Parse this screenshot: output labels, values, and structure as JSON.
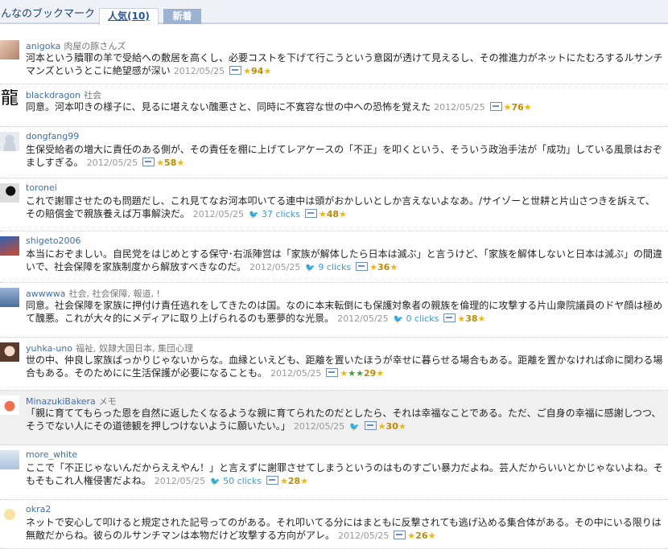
{
  "header": {
    "title": "みんなのブックマーク",
    "tab_popular": "人気(10)",
    "tab_new": "新着"
  },
  "entries": [
    {
      "user": "anigoka",
      "tags": "肉屋の豚さんズ",
      "text": "河本という贖罪の羊で受給への敷居を高くし、必要コストを下げて行こうという意図が透けて見えるし、その推進力がネットにたむろするルサンチマンズというとこに絶望感が深い",
      "date": "2012/05/25",
      "clicks": "",
      "stars": "94",
      "avatar": "avatar-photo"
    },
    {
      "user": "blackdragon",
      "tags": "社会",
      "text": "同意。河本叩きの様子に、見るに堪えない醜悪さと、同時に不寛容な世の中への恐怖を覚えた",
      "date": "2012/05/25",
      "clicks": "",
      "stars": "76",
      "avatar": "dragon-kanji",
      "kanji": "龍"
    },
    {
      "user": "dongfang99",
      "tags": "",
      "text": "生保受給者の増大に責任のある側が、その責任を棚に上げてレアケースの「不正」を叩くという、そういう政治手法が「成功」している風景はおぞましすぎる。",
      "date": "2012/05/25",
      "clicks": "",
      "stars": "58",
      "avatar": "default-silhouette"
    },
    {
      "user": "toronei",
      "tags": "",
      "text": "これで謝罪させたのも問題だし、これ見てなお河本叩いてる連中は頭がおかしいとしか言えないよなあ。/サイゾーと世耕と片山さつきを訴えて、その賠償金で親族養えば万事解決だ。",
      "date": "2012/05/25",
      "clicks": "37 clicks",
      "stars": "48",
      "avatar": "dark-figure"
    },
    {
      "user": "shigeto2006",
      "tags": "",
      "text": "本当におぞましい。自民党をはじめとする保守･右派陣営は「家族が解体したら日本は滅ぶ」と言うけど、「家族を解体しないと日本は滅ぶ」の間違いで、社会保障を家族制度から解放すべきなのだ。",
      "date": "2012/05/25",
      "clicks": "9 clicks",
      "stars": "36",
      "avatar": "avatar-blue"
    },
    {
      "user": "awwwwa",
      "tags": "社会, 社会保障, 報道, !",
      "text": "同意。社会保障を家族に押付け責任逃れをしてきたのは国。なのに本末転倒にも保護対象者の親族を倫理的に攻撃する片山衆院議員のドヤ顔は極めて醜悪。これが大々的にメディアに取り上げられるのも悪夢的な光景。",
      "date": "2012/05/25",
      "clicks": "0 clicks",
      "stars": "38",
      "avatar": "avatar-city"
    },
    {
      "user": "yuhka-uno",
      "tags": "福祉, 奴隷大国日本, 集団心理",
      "text": "世の中、仲良し家族ばっかりじゃないからな。血縁といえども、距離を置いたほうが幸せに暮らせる場合もある。距離を置かなければ命に関わる場合もある。そのためにに生活保護が必要になることも。",
      "date": "2012/05/25",
      "clicks": "",
      "stars": "29",
      "avatar": "avatar-doll",
      "green": true
    },
    {
      "user": "MinazukiBakera",
      "tags": "メモ",
      "text": "「親に育ててもらった恩を自然に返したくなるような親に育てられたのだとしたら、それは幸福なことである。ただ、ご自身の幸福に感謝しつつ、そうでない人にその道徳観を押しつけないように願いたい。」",
      "date": "2012/05/25",
      "clicks": "",
      "stars": "30",
      "avatar": "avatar-crab",
      "twitter_only": true,
      "highlight": true
    },
    {
      "user": "more_white",
      "tags": "",
      "text": "ここで「不正じゃないんだからええやん！」と言えずに謝罪させてしまうというのはものすごい暴力だよね。芸人だからいいとかじゃないよね。そもそもこれ人権侵害だよね。",
      "date": "2012/05/25",
      "clicks": "50 clicks",
      "stars": "28",
      "avatar": "avatar-plane"
    },
    {
      "user": "okra2",
      "tags": "",
      "text": "ネットで安心して叩けると規定された記号ってのがある。それ叩いてる分にはまともに反撃されても逃げ込める集合体がある。その中にいる限りは無敵だからね。彼らのルサンチマンは本物だけど攻撃する方向がアレ。",
      "date": "2012/05/25",
      "clicks": "",
      "stars": "26",
      "avatar": "avatar-face"
    }
  ]
}
